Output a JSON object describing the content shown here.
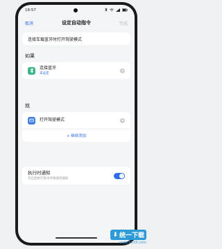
{
  "status_bar": {
    "time": "18:57",
    "icons": [
      "bluetooth-icon",
      "wifi-icon",
      "signal-icon",
      "battery-icon"
    ]
  },
  "header": {
    "cancel_label": "取消",
    "title": "设定自动指令",
    "done_label": "完成"
  },
  "command_name": "连接车载蓝牙时打开驾驶模式",
  "if_section": {
    "label": "如果",
    "item": {
      "title": "连接蓝牙",
      "subtitle": "未设定",
      "icon": "bluetooth-icon",
      "icon_bg": "#3db58a"
    }
  },
  "then_section": {
    "label": "就",
    "item": {
      "title": "打开驾驶模式",
      "icon": "car-icon",
      "icon_bg": "#3f7de0"
    },
    "add_label": "+ 继续添加"
  },
  "notify": {
    "title": "执行时通知",
    "subtitle": "开启后执行指令时将收到通知",
    "enabled": true
  },
  "watermark": {
    "brand": "统一下载",
    "url": "www.PXXX.com"
  },
  "colors": {
    "accent": "#2f6ee6",
    "background": "#f4f5f7"
  }
}
